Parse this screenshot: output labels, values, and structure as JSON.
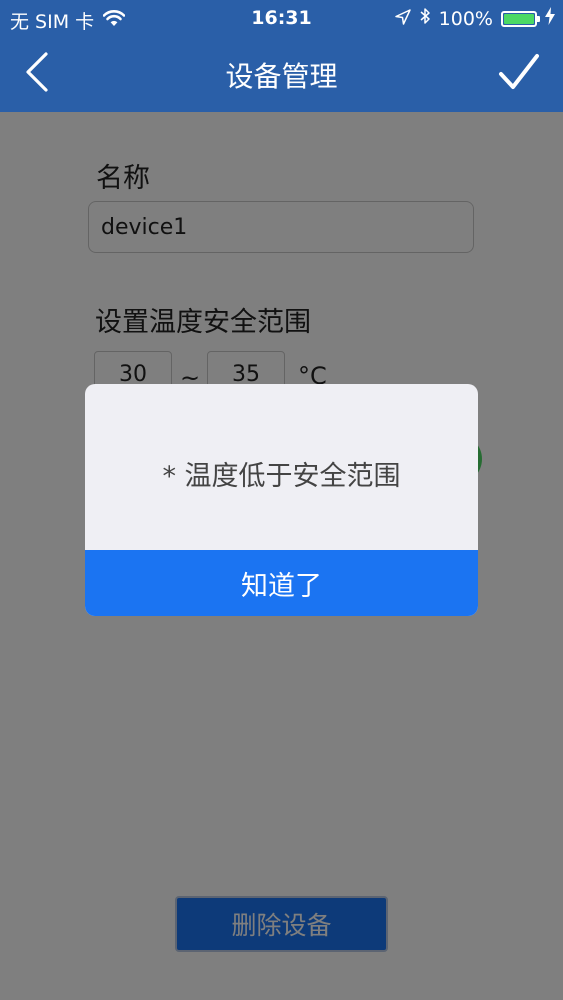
{
  "status_bar": {
    "carrier": "无 SIM 卡",
    "time": "16:31",
    "battery_percent": "100%",
    "battery_level": 1.0,
    "icons": [
      "wifi-icon",
      "location-arrow-icon",
      "bluetooth-icon",
      "battery-icon",
      "charging-bolt-icon"
    ]
  },
  "nav": {
    "title": "设备管理",
    "back_icon": "chevron-left-icon",
    "confirm_icon": "checkmark-icon"
  },
  "form": {
    "name_label": "名称",
    "name_value": "device1",
    "range_label": "设置温度安全范围",
    "temp_min": "30",
    "range_separator": "~",
    "temp_max": "35",
    "temp_unit": "°C",
    "alarm_toggle_on": true
  },
  "delete_button": "删除设备",
  "dialog": {
    "message": "* 温度低于安全范围",
    "button": "知道了"
  },
  "colors": {
    "header": "#2a5fa8",
    "primary": "#1b74f2",
    "dialog_bg": "#efeff4",
    "toggle_on": "#4cd964",
    "overlay": "rgba(0,0,0,0.5)"
  }
}
